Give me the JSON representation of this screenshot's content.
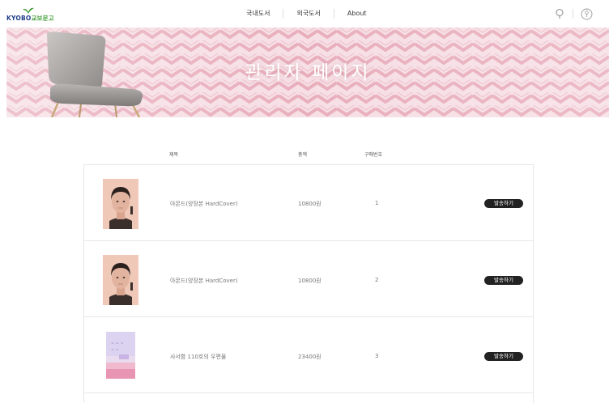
{
  "brand": {
    "logo_en": "KYOBO",
    "logo_ko": "교보문고",
    "color_blue": "#1f3f8a",
    "color_green": "#3d9b35"
  },
  "nav": {
    "items": [
      "국내도서",
      "외국도서",
      "About"
    ]
  },
  "header_icons": [
    "search-icon",
    "user-icon"
  ],
  "banner": {
    "title": "관리자 페이지",
    "background": "#f5dde3"
  },
  "table": {
    "columns": {
      "title": "제목",
      "amount": "총액",
      "order_no": "구매번호"
    },
    "rows": [
      {
        "cover": "almond-cover",
        "title": "아몬드(양장본 HardCover)",
        "amount": "10800원",
        "order_no": "1",
        "action": "발송하기"
      },
      {
        "cover": "almond-cover",
        "title": "아몬드(양장본 HardCover)",
        "amount": "10800원",
        "order_no": "2",
        "action": "발송하기"
      },
      {
        "cover": "pastel-book-cover",
        "title": "사서함 110호의 우편물",
        "amount": "23400원",
        "order_no": "3",
        "action": "발송하기"
      }
    ]
  }
}
